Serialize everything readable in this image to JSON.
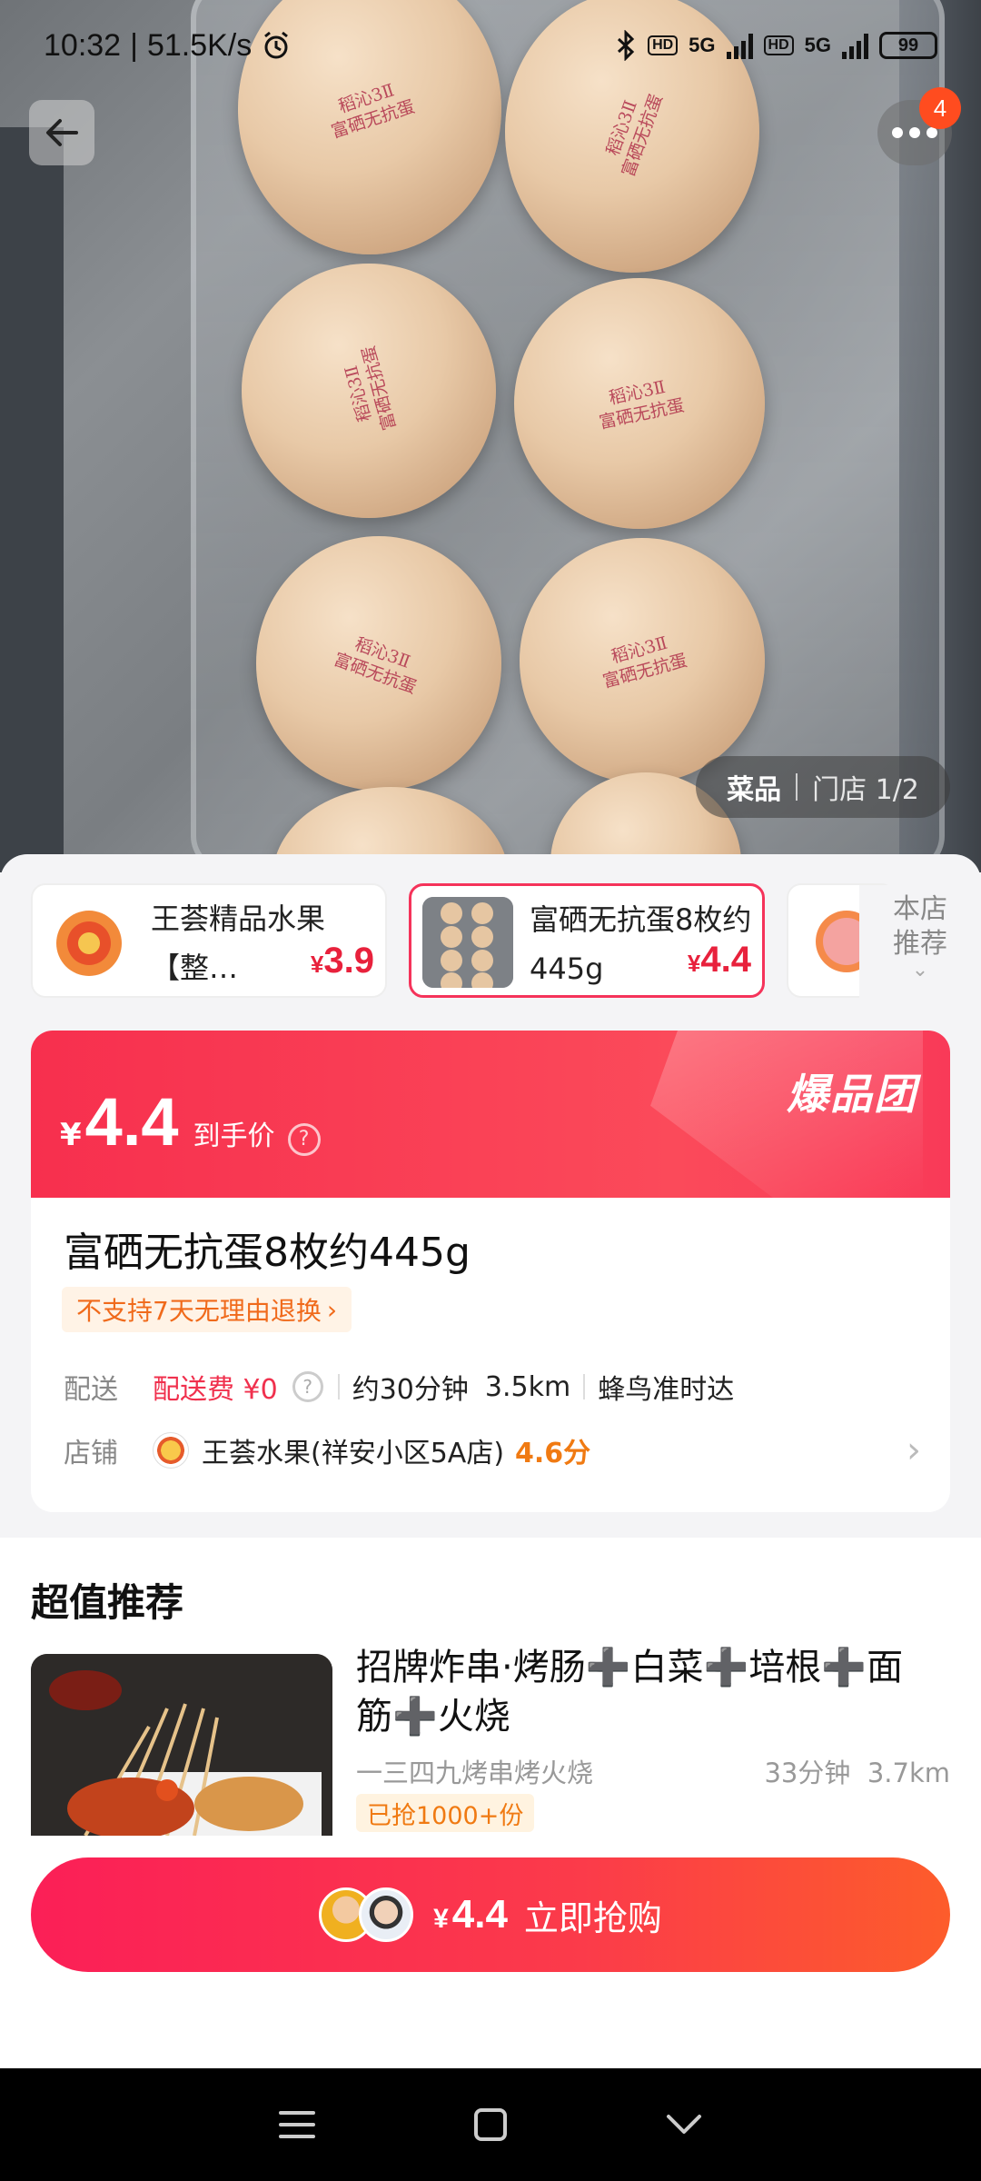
{
  "status_bar": {
    "time": "10:32",
    "speed": "51.5K/s",
    "net1": "5G",
    "net2": "5G",
    "hd": "HD",
    "battery": "99"
  },
  "header": {
    "badge_count": "4"
  },
  "egg_stamp": {
    "line1": "稻沁3Ⅱ",
    "line2": "富硒无抗蛋"
  },
  "image_tabs": {
    "active": "菜品",
    "inactive": "门店 1/2"
  },
  "chips": [
    {
      "name": "王荟精品水果【整…",
      "currency": "¥",
      "price": "3.9",
      "selected": false
    },
    {
      "name": "富硒无抗蛋8枚约445g",
      "currency": "¥",
      "price": "4.4",
      "selected": true
    }
  ],
  "store_recommend": {
    "label": "本店推荐"
  },
  "promo": {
    "currency": "¥",
    "price": "4.4",
    "price_label": "到手价",
    "brand": "爆品团"
  },
  "product": {
    "title": "富硒无抗蛋8枚约445g",
    "return_policy": "不支持7天无理由退换",
    "delivery_label": "配送",
    "delivery_fee": "配送费 ¥0",
    "delivery_time": "约30分钟",
    "delivery_distance": "3.5km",
    "delivery_service": "蜂鸟准时达",
    "store_label": "店铺",
    "store_name": "王荟水果(祥安小区5A店)",
    "store_rating": "4.6分"
  },
  "recommendations": {
    "title": "超值推荐",
    "items": [
      {
        "name": "招牌炸串·烤肠➕白菜➕培根➕面筋➕火烧",
        "shop": "一三四九烤串烤火烧",
        "time": "33分钟",
        "distance": "3.7km",
        "sold": "已抢1000+份"
      }
    ]
  },
  "buy_button": {
    "currency": "¥",
    "price": "4.4",
    "label": "立即抢购"
  },
  "colors": {
    "accent": "#f5335a",
    "price_red": "#e8213c",
    "orange": "#f07a12"
  }
}
